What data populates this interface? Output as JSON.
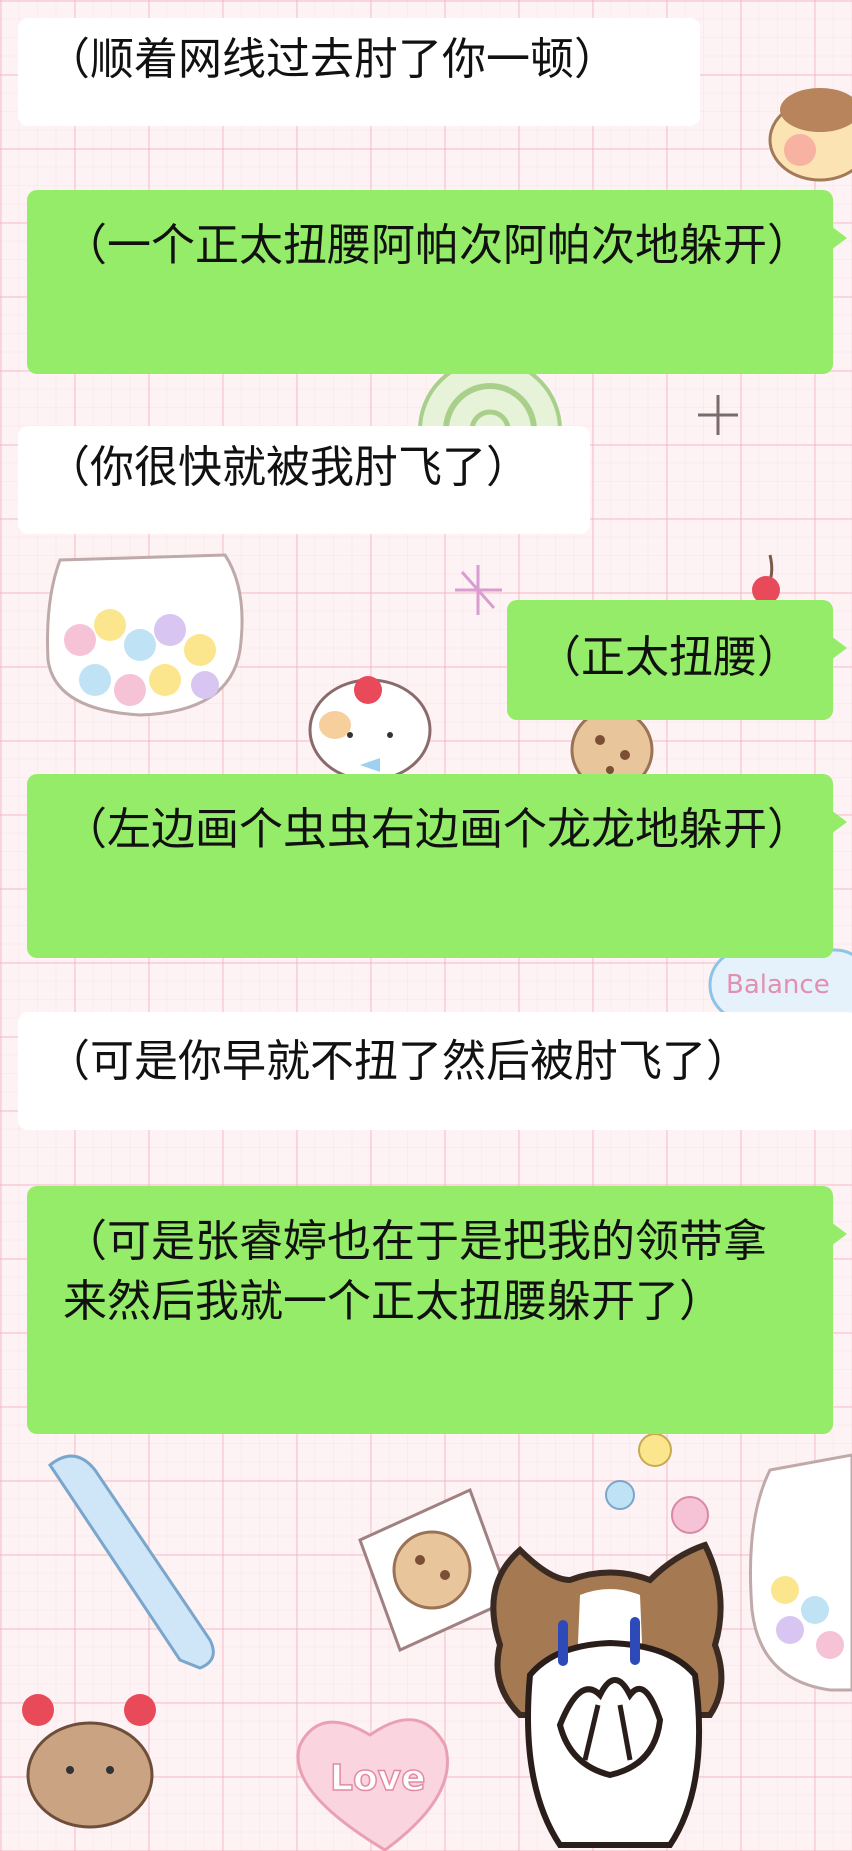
{
  "messages": [
    {
      "side": "left",
      "text": "（顺着网线过去肘了你一顿）"
    },
    {
      "side": "right",
      "text": "（一个正太扭腰阿帕次阿帕次地躲开）"
    },
    {
      "side": "left",
      "text": "（你很快就被我肘飞了）"
    },
    {
      "side": "right",
      "text": "（正太扭腰）"
    },
    {
      "side": "right",
      "text": "（左边画个虫虫右边画个龙龙地躲开）"
    },
    {
      "side": "left",
      "text": "（可是你早就不扭了然后被肘飞了）"
    },
    {
      "side": "right",
      "text": "（可是张睿婷也在于是把我的领带拿来然后我就一个正太扭腰躲开了）"
    }
  ],
  "wallpaper": {
    "balance_text": "Balance",
    "love_text": "Love"
  },
  "sticker": {
    "icon": "covering-face-cat-sticker"
  },
  "colors": {
    "incoming_bubble": "#ffffff",
    "outgoing_bubble": "#95ec69"
  }
}
